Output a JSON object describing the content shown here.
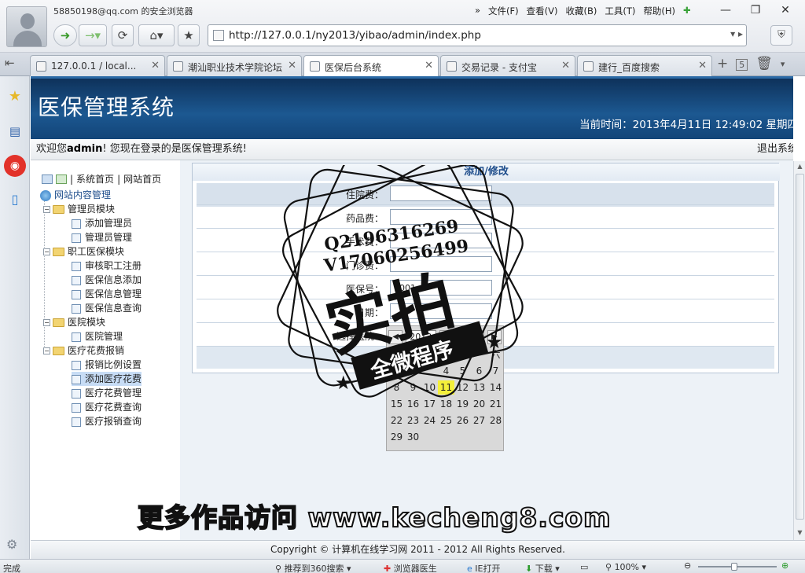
{
  "browser": {
    "user": "58850198@qq.com 的安全浏览器",
    "menu": [
      "文件(F)",
      "查看(V)",
      "收藏(B)",
      "工具(T)",
      "帮助(H)"
    ],
    "address_url": "http://127.0.0.1/ny2013/yibao/admin/index.php",
    "tabs": [
      {
        "title": "127.0.0.1 / local..."
      },
      {
        "title": "潮汕职业技术学院论坛"
      },
      {
        "title": "医保后台系统"
      },
      {
        "title": "交易记录 - 支付宝"
      },
      {
        "title": "建行_百度搜索"
      }
    ],
    "tab_count": "5",
    "status_left": "完成",
    "status_items": [
      "推荐到360搜索",
      "浏览器医生",
      "IE打开",
      "下载",
      "100%"
    ]
  },
  "site": {
    "title": "医保管理系统",
    "time_label": "当前时间：",
    "time_value": "2013年4月11日  12:49:02 星期四",
    "welcome_pre": "欢迎您",
    "welcome_user": "admin",
    "welcome_post": "! 您现在登录的是医保管理系统!",
    "logout": "退出系统",
    "footer": "Copyright © 计算机在线学习网  2011 - 2012 All Rights Reserved."
  },
  "nav": {
    "top_links": [
      "系统首页",
      "网站首页"
    ],
    "root": "网站内容管理",
    "groups": [
      {
        "label": "管理员模块",
        "items": [
          "添加管理员",
          "管理员管理"
        ]
      },
      {
        "label": "职工医保模块",
        "items": [
          "审核职工注册",
          "医保信息添加",
          "医保信息管理",
          "医保信息查询"
        ]
      },
      {
        "label": "医院模块",
        "items": [
          "医院管理"
        ]
      },
      {
        "label": "医疗花费报销",
        "items": [
          "报销比例设置",
          "添加医疗花费",
          "医疗花费管理",
          "医疗花费查询",
          "医疗报销查询"
        ]
      }
    ]
  },
  "form": {
    "title": "添加/修改",
    "fields": [
      {
        "label": "住院费：",
        "value": ""
      },
      {
        "label": "药品费：",
        "value": ""
      },
      {
        "label": "手术费：",
        "value": ""
      },
      {
        "label": "门诊费：",
        "value": ""
      },
      {
        "label": "医保号：",
        "value": "1001"
      },
      {
        "label": "日期：",
        "value": ""
      },
      {
        "label": "选择医院：",
        "value": ""
      }
    ]
  },
  "calendar": {
    "year": "2013",
    "today_btn": "今",
    "weekday_hint": "六",
    "days": [
      "",
      "1",
      "2",
      "3",
      "4",
      "5",
      "6",
      "7",
      "8",
      "9",
      "10",
      "11",
      "12",
      "13",
      "14",
      "15",
      "16",
      "17",
      "18",
      "19",
      "20",
      "21",
      "22",
      "23",
      "24",
      "25",
      "26",
      "27",
      "28",
      "29",
      "30"
    ],
    "highlight": "11"
  },
  "watermark": {
    "qq": "Q2196316269",
    "v": "V17060256499",
    "big": "实拍",
    "ribbon": "全微程序",
    "site": "更多作品访问 www.kecheng8.com"
  }
}
